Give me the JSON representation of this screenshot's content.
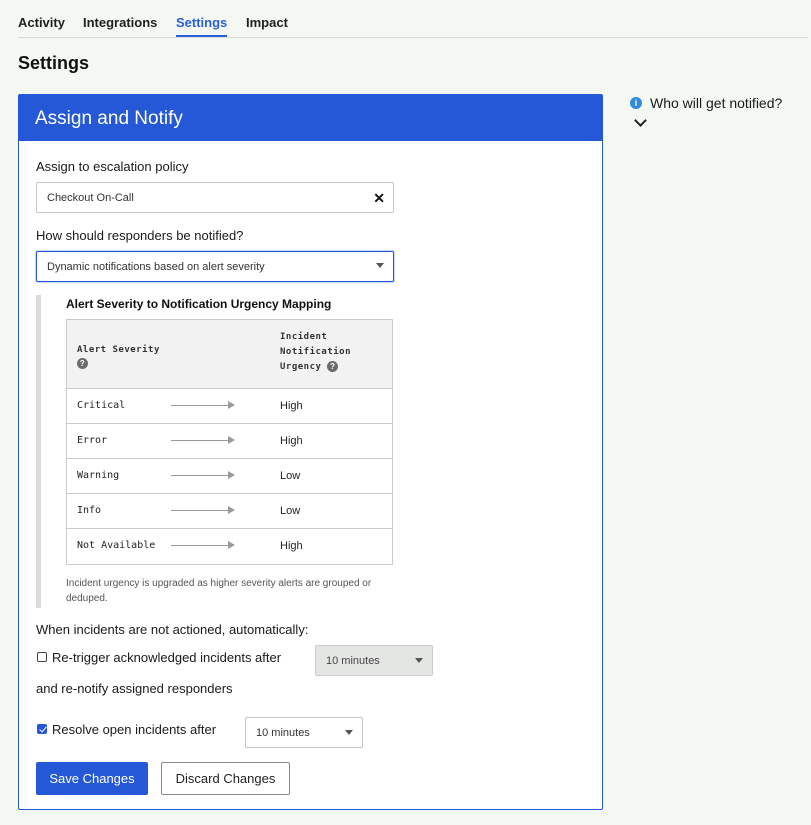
{
  "tabs": [
    {
      "label": "Activity",
      "active": false
    },
    {
      "label": "Integrations",
      "active": false
    },
    {
      "label": "Settings",
      "active": true
    },
    {
      "label": "Impact",
      "active": false
    }
  ],
  "page_title": "Settings",
  "card": {
    "title": "Assign and Notify",
    "escalation_label": "Assign to escalation policy",
    "escalation_value": "Checkout On-Call",
    "clear_glyph": "✕",
    "notify_label": "How should responders be notified?",
    "notify_value": "Dynamic notifications based on alert severity",
    "mapping": {
      "title": "Alert Severity to Notification Urgency Mapping",
      "col_severity": "Alert Severity",
      "col_urgency": "Incident Notification Urgency",
      "help_glyph": "?",
      "rows": [
        {
          "severity": "Critical",
          "urgency": "High"
        },
        {
          "severity": "Error",
          "urgency": "High"
        },
        {
          "severity": "Warning",
          "urgency": "Low"
        },
        {
          "severity": "Info",
          "urgency": "Low"
        },
        {
          "severity": "Not Available",
          "urgency": "High"
        }
      ],
      "note": "Incident urgency is upgraded as higher severity alerts are grouped or deduped."
    },
    "not_actioned_label": "When incidents are not actioned, automatically:",
    "retrigger": {
      "checked": false,
      "label": "Re-trigger acknowledged incidents after",
      "value": "10 minutes",
      "suffix": "and re-notify assigned responders"
    },
    "resolve": {
      "checked": true,
      "label": "Resolve open incidents after",
      "value": "10 minutes"
    },
    "save_label": "Save Changes",
    "discard_label": "Discard Changes"
  },
  "side": {
    "info_glyph": "i",
    "title": "Who will get notified?"
  },
  "colors": {
    "accent": "#2458d6",
    "background": "#f4f8f3",
    "info": "#2e8be0"
  }
}
